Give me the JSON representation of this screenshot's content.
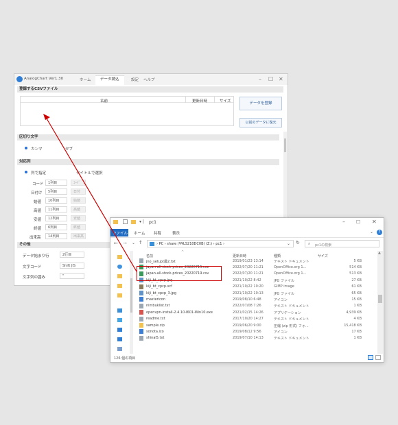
{
  "analogchart": {
    "app_title": "AnalogChart Ver1.30",
    "menu": [
      "ホーム",
      "データ読込",
      "設定",
      "ヘルプ"
    ],
    "section_csv": "登録するCSVファイル",
    "col_name": "名前",
    "col_date": "更新日時",
    "col_size": "サイズ",
    "btn_register": "データを登録",
    "btn_restore": "以前のデータに復元",
    "section_delim": "区切り文字",
    "delim_comma": "カンマ",
    "delim_tab": "タブ",
    "section_target": "対応列",
    "radio_col": "列で指定",
    "radio_title": "タイトルで選択",
    "fields": [
      {
        "label": "コード",
        "col": "1列目",
        "name": "ｺｰﾄﾞ"
      },
      {
        "label": "日付け",
        "col": "5列目",
        "name": "日付"
      },
      {
        "label": "始値",
        "col": "10列目",
        "name": "始値"
      },
      {
        "label": "高値",
        "col": "11列目",
        "name": "高値"
      },
      {
        "label": "安値",
        "col": "12列目",
        "name": "安値"
      },
      {
        "label": "終値",
        "col": "6列目",
        "name": "終値"
      },
      {
        "label": "出来高",
        "col": "14列目",
        "name": "出来高"
      }
    ],
    "section_other": "その他",
    "start_row_label": "データ始まり行",
    "start_row_value": "2行目",
    "encoding_label": "文字コード",
    "encoding_value": "Shift JIS",
    "quote_label": "文字列の囲み",
    "quote_value": "\""
  },
  "explorer": {
    "title": "pc1",
    "ribbon": [
      "ファイル",
      "ホーム",
      "共有",
      "表示"
    ],
    "path": [
      "PC",
      "share (¥¥LS210DC0B) (Z:)",
      "pc1"
    ],
    "search_placeholder": "pc1の検索",
    "headers": {
      "name": "名前",
      "date": "更新日時",
      "type": "種類",
      "size": "サイズ"
    },
    "rows": [
      {
        "name": "jno_setup(最2.txt",
        "date": "2019/01/23 13:14",
        "type": "テキスト ドキュメント",
        "size": "5 KB"
      },
      {
        "name": "japan-all-stock-prices_20220715.csv",
        "date": "2022/07/20 11:21",
        "type": "OpenOffice.org 1...",
        "size": "514 KB"
      },
      {
        "name": "japan-all-stock-prices_20220719.csv",
        "date": "2022/07/20 11:21",
        "type": "OpenOffice.org 1...",
        "size": "513 KB"
      },
      {
        "name": "kiji_bt_cpcp.jpg",
        "date": "2021/10/22 8:42",
        "type": "JPG ファイル",
        "size": "27 KB"
      },
      {
        "name": "kiji_bt_cpcp.xcf",
        "date": "2021/10/22 10:20",
        "type": "GIMP image",
        "size": "61 KB"
      },
      {
        "name": "kiji_bt_cpcp_3.jpg",
        "date": "2021/10/22 10:13",
        "type": "JPG ファイル",
        "size": "65 KB"
      },
      {
        "name": "mastericon",
        "date": "2019/08/10 6:48",
        "type": "アイコン",
        "size": "15 KB"
      },
      {
        "name": "nimbuklist.txt",
        "date": "2022/07/08 7:26",
        "type": "テキスト ドキュメント",
        "size": "1 KB"
      },
      {
        "name": "openvpn-install-2.4.10-I601-Win10.exe",
        "date": "2021/02/15 14:26",
        "type": "アプリケーション",
        "size": "4,939 KB"
      },
      {
        "name": "readme.txt",
        "date": "2017/10/20 14:27",
        "type": "テキスト ドキュメント",
        "size": "4 KB"
      },
      {
        "name": "sample.zip",
        "date": "2019/06/20 9:00",
        "type": "圧縮 (zip 形式) フォ...",
        "size": "15,418 KB"
      },
      {
        "name": "sonota.ico",
        "date": "2019/08/12 9:56",
        "type": "アイコン",
        "size": "17 KB"
      },
      {
        "name": "shinai5.txt",
        "date": "2019/07/10 14:13",
        "type": "テキスト ドキュメント",
        "size": "1 KB"
      }
    ],
    "status": "126 個の項目"
  },
  "colors": {
    "accent": "#2f7fd6",
    "highlight": "#cc0000"
  }
}
